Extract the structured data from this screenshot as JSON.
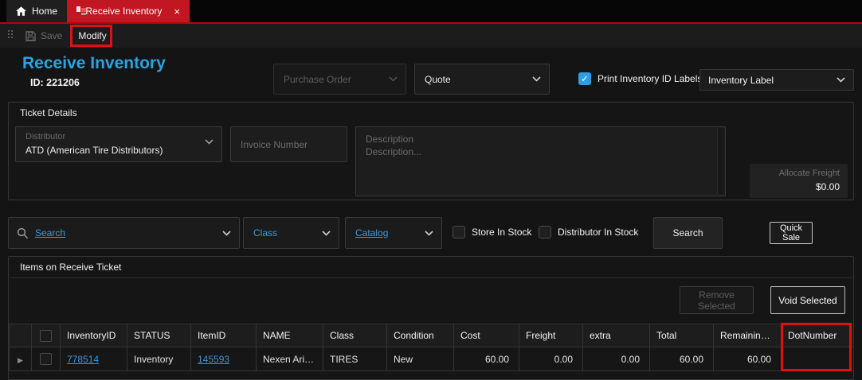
{
  "window": {
    "tabs": [
      {
        "label": "Home"
      },
      {
        "label": "Receive Inventory"
      }
    ]
  },
  "toolbar": {
    "save_label": "Save",
    "modify_label": "Modify"
  },
  "header": {
    "title": "Receive Inventory",
    "ticket_id": "ID: 221206",
    "purchase_order_placeholder": "Purchase Order",
    "quote_placeholder": "Quote",
    "print_labels_label": "Print Inventory ID Labels",
    "print_labels_checked": true,
    "label_type_value": "Inventory Label"
  },
  "ticket_details": {
    "section_title": "Ticket Details",
    "distributor_label": "Distributor",
    "distributor_value": "ATD (American Tire Distributors)",
    "invoice_placeholder": "Invoice Number",
    "description_placeholder_line1": "Description",
    "description_placeholder_line2": "Description...",
    "allocate_freight_label": "Allocate Freight",
    "allocate_freight_value": "$0.00"
  },
  "search_bar": {
    "search_placeholder": "Search",
    "class_placeholder": "Class",
    "catalog_placeholder": "Catalog",
    "store_in_stock_label": "Store In Stock",
    "distributor_in_stock_label": "Distributor In Stock",
    "search_button_label": "Search",
    "quick_sale_button_label": "Quick Sale"
  },
  "items": {
    "section_title": "Items on Receive Ticket",
    "remove_selected_label": "Remove Selected",
    "void_selected_label": "Void Selected",
    "table": {
      "columns": [
        "InventoryID",
        "STATUS",
        "ItemID",
        "NAME",
        "Class",
        "Condition",
        "Cost",
        "Freight",
        "extra",
        "Total",
        "RemainingB...",
        "DotNumber"
      ],
      "rows": [
        [
          "778514",
          "Inventory",
          "145593",
          "Nexen Aria ...",
          "TIRES",
          "New",
          "60.00",
          "0.00",
          "0.00",
          "60.00",
          "60.00",
          ""
        ]
      ]
    }
  },
  "icons": {
    "close": "×",
    "check": "✓",
    "expand_row": "▶"
  },
  "colors": {
    "accent_red": "#c00000",
    "annotation_red": "#e01010",
    "title_blue": "#2ba3e0",
    "link_blue": "#3f93d8",
    "checkbox_blue": "#2d9fe8"
  }
}
